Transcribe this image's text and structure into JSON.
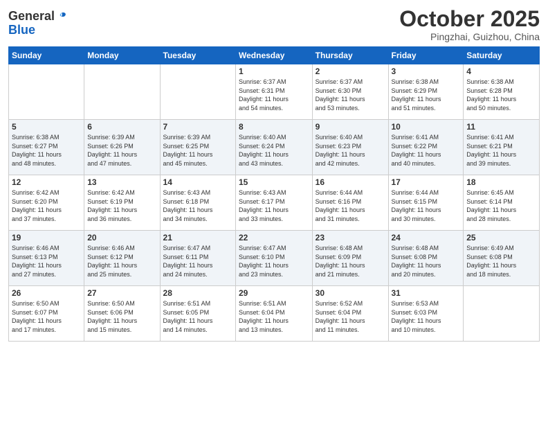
{
  "header": {
    "logo_general": "General",
    "logo_blue": "Blue",
    "month": "October 2025",
    "location": "Pingzhai, Guizhou, China"
  },
  "weekdays": [
    "Sunday",
    "Monday",
    "Tuesday",
    "Wednesday",
    "Thursday",
    "Friday",
    "Saturday"
  ],
  "weeks": [
    [
      {
        "day": "",
        "info": ""
      },
      {
        "day": "",
        "info": ""
      },
      {
        "day": "",
        "info": ""
      },
      {
        "day": "1",
        "info": "Sunrise: 6:37 AM\nSunset: 6:31 PM\nDaylight: 11 hours\nand 54 minutes."
      },
      {
        "day": "2",
        "info": "Sunrise: 6:37 AM\nSunset: 6:30 PM\nDaylight: 11 hours\nand 53 minutes."
      },
      {
        "day": "3",
        "info": "Sunrise: 6:38 AM\nSunset: 6:29 PM\nDaylight: 11 hours\nand 51 minutes."
      },
      {
        "day": "4",
        "info": "Sunrise: 6:38 AM\nSunset: 6:28 PM\nDaylight: 11 hours\nand 50 minutes."
      }
    ],
    [
      {
        "day": "5",
        "info": "Sunrise: 6:38 AM\nSunset: 6:27 PM\nDaylight: 11 hours\nand 48 minutes."
      },
      {
        "day": "6",
        "info": "Sunrise: 6:39 AM\nSunset: 6:26 PM\nDaylight: 11 hours\nand 47 minutes."
      },
      {
        "day": "7",
        "info": "Sunrise: 6:39 AM\nSunset: 6:25 PM\nDaylight: 11 hours\nand 45 minutes."
      },
      {
        "day": "8",
        "info": "Sunrise: 6:40 AM\nSunset: 6:24 PM\nDaylight: 11 hours\nand 43 minutes."
      },
      {
        "day": "9",
        "info": "Sunrise: 6:40 AM\nSunset: 6:23 PM\nDaylight: 11 hours\nand 42 minutes."
      },
      {
        "day": "10",
        "info": "Sunrise: 6:41 AM\nSunset: 6:22 PM\nDaylight: 11 hours\nand 40 minutes."
      },
      {
        "day": "11",
        "info": "Sunrise: 6:41 AM\nSunset: 6:21 PM\nDaylight: 11 hours\nand 39 minutes."
      }
    ],
    [
      {
        "day": "12",
        "info": "Sunrise: 6:42 AM\nSunset: 6:20 PM\nDaylight: 11 hours\nand 37 minutes."
      },
      {
        "day": "13",
        "info": "Sunrise: 6:42 AM\nSunset: 6:19 PM\nDaylight: 11 hours\nand 36 minutes."
      },
      {
        "day": "14",
        "info": "Sunrise: 6:43 AM\nSunset: 6:18 PM\nDaylight: 11 hours\nand 34 minutes."
      },
      {
        "day": "15",
        "info": "Sunrise: 6:43 AM\nSunset: 6:17 PM\nDaylight: 11 hours\nand 33 minutes."
      },
      {
        "day": "16",
        "info": "Sunrise: 6:44 AM\nSunset: 6:16 PM\nDaylight: 11 hours\nand 31 minutes."
      },
      {
        "day": "17",
        "info": "Sunrise: 6:44 AM\nSunset: 6:15 PM\nDaylight: 11 hours\nand 30 minutes."
      },
      {
        "day": "18",
        "info": "Sunrise: 6:45 AM\nSunset: 6:14 PM\nDaylight: 11 hours\nand 28 minutes."
      }
    ],
    [
      {
        "day": "19",
        "info": "Sunrise: 6:46 AM\nSunset: 6:13 PM\nDaylight: 11 hours\nand 27 minutes."
      },
      {
        "day": "20",
        "info": "Sunrise: 6:46 AM\nSunset: 6:12 PM\nDaylight: 11 hours\nand 25 minutes."
      },
      {
        "day": "21",
        "info": "Sunrise: 6:47 AM\nSunset: 6:11 PM\nDaylight: 11 hours\nand 24 minutes."
      },
      {
        "day": "22",
        "info": "Sunrise: 6:47 AM\nSunset: 6:10 PM\nDaylight: 11 hours\nand 23 minutes."
      },
      {
        "day": "23",
        "info": "Sunrise: 6:48 AM\nSunset: 6:09 PM\nDaylight: 11 hours\nand 21 minutes."
      },
      {
        "day": "24",
        "info": "Sunrise: 6:48 AM\nSunset: 6:08 PM\nDaylight: 11 hours\nand 20 minutes."
      },
      {
        "day": "25",
        "info": "Sunrise: 6:49 AM\nSunset: 6:08 PM\nDaylight: 11 hours\nand 18 minutes."
      }
    ],
    [
      {
        "day": "26",
        "info": "Sunrise: 6:50 AM\nSunset: 6:07 PM\nDaylight: 11 hours\nand 17 minutes."
      },
      {
        "day": "27",
        "info": "Sunrise: 6:50 AM\nSunset: 6:06 PM\nDaylight: 11 hours\nand 15 minutes."
      },
      {
        "day": "28",
        "info": "Sunrise: 6:51 AM\nSunset: 6:05 PM\nDaylight: 11 hours\nand 14 minutes."
      },
      {
        "day": "29",
        "info": "Sunrise: 6:51 AM\nSunset: 6:04 PM\nDaylight: 11 hours\nand 13 minutes."
      },
      {
        "day": "30",
        "info": "Sunrise: 6:52 AM\nSunset: 6:04 PM\nDaylight: 11 hours\nand 11 minutes."
      },
      {
        "day": "31",
        "info": "Sunrise: 6:53 AM\nSunset: 6:03 PM\nDaylight: 11 hours\nand 10 minutes."
      },
      {
        "day": "",
        "info": ""
      }
    ]
  ]
}
